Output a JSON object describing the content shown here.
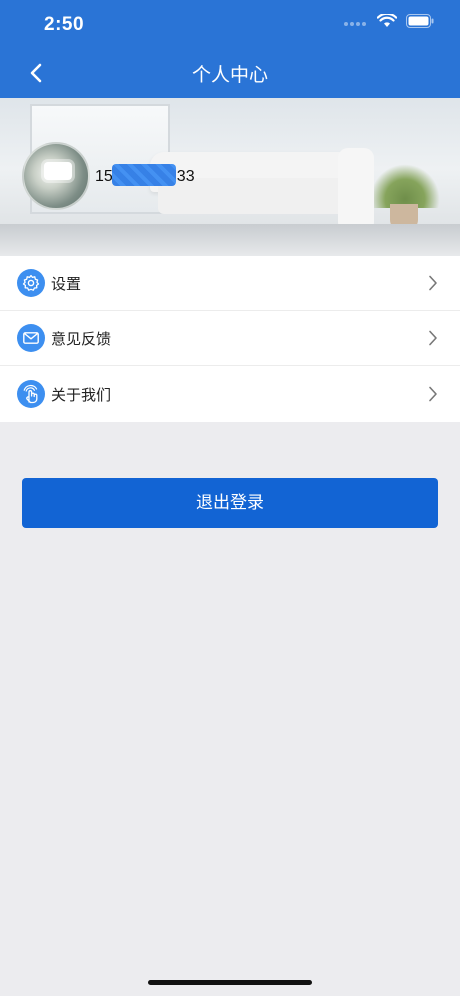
{
  "status_bar": {
    "time": "2:50",
    "icons": [
      "signal-dots-icon",
      "wifi-icon",
      "battery-icon"
    ]
  },
  "nav": {
    "title": "个人中心",
    "back_icon": "chevron-left-icon"
  },
  "profile": {
    "phone_prefix": "15",
    "phone_suffix": "33",
    "phone_masked": true,
    "avatar": "avatar-image"
  },
  "menu": {
    "items": [
      {
        "label": "设置",
        "icon": "gear-icon"
      },
      {
        "label": "意见反馈",
        "icon": "mail-icon"
      },
      {
        "label": "关于我们",
        "icon": "hand-touch-icon"
      }
    ],
    "chevron_icon": "chevron-right-icon"
  },
  "logout": {
    "label": "退出登录"
  },
  "colors": {
    "primary": "#2a74d6",
    "button": "#1264d4",
    "icon_bg": "#3d8ff0",
    "background": "#ececef"
  }
}
